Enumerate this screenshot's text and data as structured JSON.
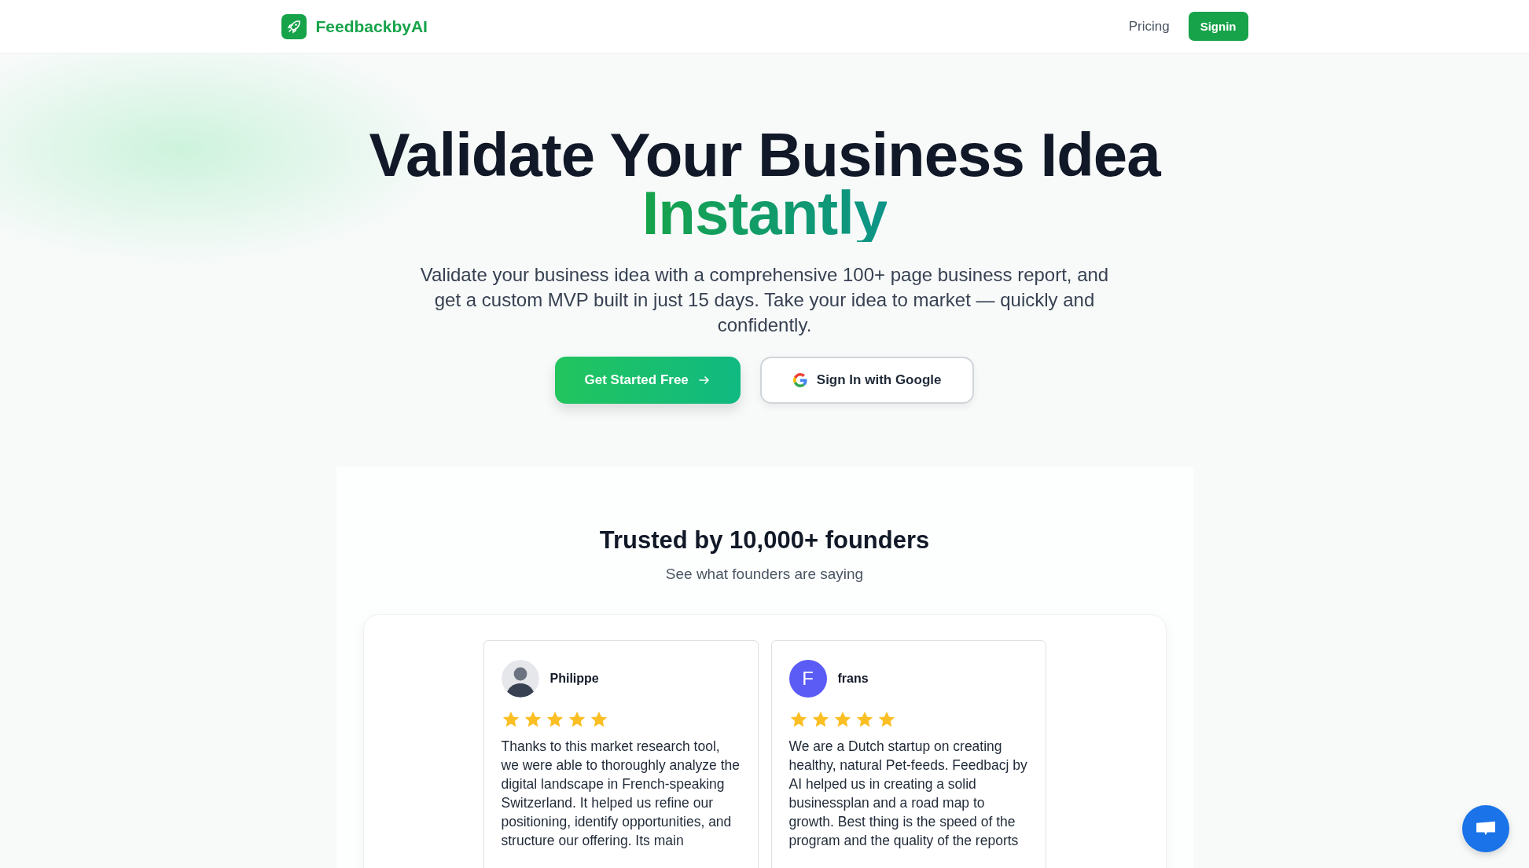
{
  "header": {
    "brand": "FeedbackbyAI",
    "nav": [
      {
        "label": "Pricing",
        "kind": "link"
      },
      {
        "label": "Signin",
        "kind": "button"
      }
    ]
  },
  "hero": {
    "title": "Validate Your Business Idea",
    "title_accent": "Instantly",
    "subtitle": "Validate your business idea with a comprehensive 100+ page business report, and get a custom MVP built in just 15 days. Take your idea to market — quickly and confidently.",
    "primary_button": "Get Started Free",
    "google_button": "Sign In with Google"
  },
  "testimonials": {
    "title": "Trusted by 10,000+ founders",
    "subtitle": "See what founders are saying",
    "items": [
      {
        "name": "Philippe",
        "kind": "photo",
        "stars": 5,
        "text": "Thanks to this market research tool, we were able to thoroughly analyze the digital landscape in French-speaking Switzerland. It helped us refine our positioning, identify opportunities, and structure our offering. Its main"
      },
      {
        "name": "frans",
        "kind": "letter",
        "avatar_letter": "F",
        "color": "#5b5bf6",
        "stars": 5,
        "text": "We are a Dutch startup on creating healthy, natural Pet-feeds. Feedbacj by AI helped us in creating a solid businessplan and a road map to growth. Best thing is the speed of the program and the quality of the reports"
      }
    ]
  }
}
